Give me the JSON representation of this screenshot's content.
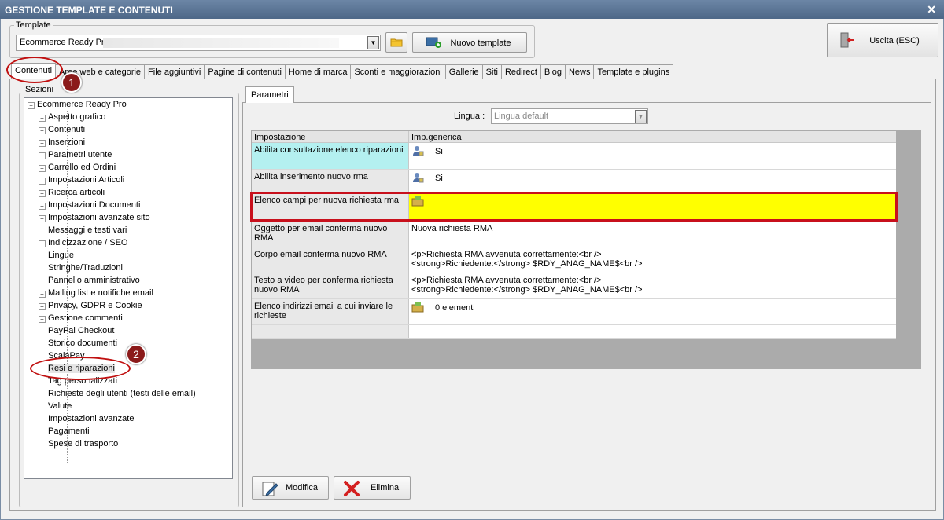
{
  "window": {
    "title": "GESTIONE TEMPLATE E CONTENUTI",
    "close": "✕"
  },
  "template": {
    "legend": "Template",
    "selected": "Ecommerce Ready Pro",
    "new_button": "Nuovo template"
  },
  "exit_button": "Uscita (ESC)",
  "tabs": [
    "Contenuti",
    "Aree web e categorie",
    "File aggiuntivi",
    "Pagine di contenuti",
    "Home di marca",
    "Sconti e maggiorazioni",
    "Gallerie",
    "Siti",
    "Redirect",
    "Blog",
    "News",
    "Template e plugins"
  ],
  "sections": {
    "legend": "Sezioni",
    "root": "Ecommerce Ready Pro",
    "items": [
      "Aspetto grafico",
      "Contenuti",
      "Inserzioni",
      "Parametri utente",
      "Carrello ed Ordini",
      "Impostazioni Articoli",
      "Ricerca articoli",
      "Impostazioni Documenti",
      "Impostazioni avanzate sito",
      "Messaggi e testi vari",
      "Indicizzazione / SEO",
      "Lingue",
      "Stringhe/Traduzioni",
      "Pannello amministrativo",
      "Mailing list e notifiche email",
      "Privacy, GDPR e Cookie",
      "Gestione commenti",
      "PayPal Checkout",
      "Storico documenti",
      "ScalaPay",
      "Resi e riparazioni",
      "Tag personalizzati",
      "Richieste degli utenti (testi delle email)",
      "Valute",
      "Impostazioni avanzate",
      "Pagamenti",
      "Spese di trasporto"
    ]
  },
  "badges": {
    "one": "1",
    "two": "2"
  },
  "params": {
    "tab": "Parametri",
    "lingua_label": "Lingua :",
    "lingua_value": "Lingua default",
    "col_setting": "Impostazione",
    "col_value": "Imp.generica",
    "rows": [
      {
        "setting": "Abilita consultazione elenco riparazioni",
        "value": "Si"
      },
      {
        "setting": "Abilita inserimento nuovo rma",
        "value": "Si"
      },
      {
        "setting": "Elenco campi per nuova richiesta rma",
        "value": ""
      },
      {
        "setting": "Oggetto per email conferma nuovo RMA",
        "value": "Nuova richiesta RMA"
      },
      {
        "setting": "Corpo email conferma nuovo RMA",
        "value1": "<p>Richiesta RMA avvenuta correttamente:<br />",
        "value2": "<strong>Richiedente:</strong> $RDY_ANAG_NAME$<br />"
      },
      {
        "setting1": "Testo a video per conferma richiesta",
        "setting2": "nuovo RMA",
        "value1": "<p>Richiesta RMA avvenuta correttamente:<br />",
        "value2": "<strong>Richiedente:</strong> $RDY_ANAG_NAME$<br />"
      },
      {
        "setting1": "Elenco indirizzi email a cui inviare le",
        "setting2": "richieste",
        "value": "0 elementi"
      }
    ]
  },
  "actions": {
    "edit": "Modifica",
    "delete": "Elimina"
  },
  "colors": {
    "title_bar": "#5a7496",
    "highlight_row": "#ffff00",
    "highlight_border": "#c8101c",
    "accent_cell": "#b4f0f0"
  }
}
